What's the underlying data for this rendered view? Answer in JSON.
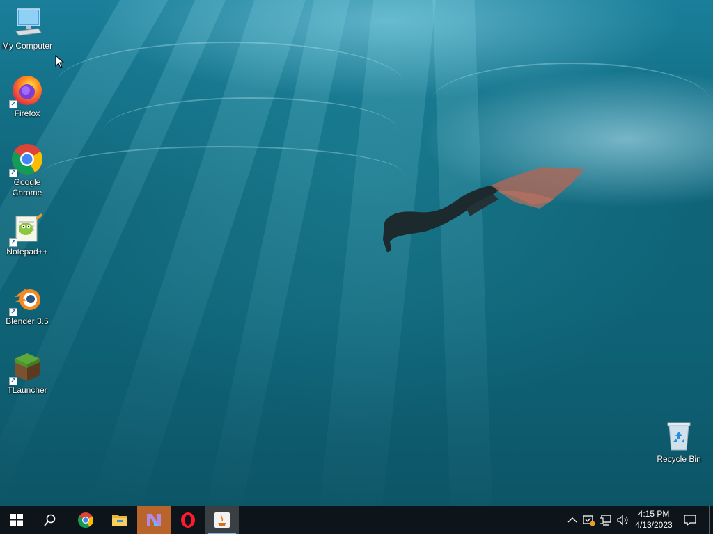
{
  "desktop": {
    "icons": [
      {
        "label": "My Computer"
      },
      {
        "label": "Firefox"
      },
      {
        "label": "Google Chrome"
      },
      {
        "label": "Notepad++"
      },
      {
        "label": "Blender 3.5"
      },
      {
        "label": "TLauncher"
      },
      {
        "label": "Recycle Bin"
      }
    ]
  },
  "taskbar": {
    "pinned": [
      "start-icon",
      "search-icon",
      "chrome-icon",
      "file-explorer-icon",
      "visual-studio-installer-icon",
      "opera-icon",
      "java-icon"
    ],
    "clock": {
      "time": "4:15 PM",
      "date": "4/13/2023"
    }
  },
  "colors": {
    "taskbar": "#0e151a",
    "accent": "#7fb3e8",
    "highlight": "#b8642a"
  }
}
